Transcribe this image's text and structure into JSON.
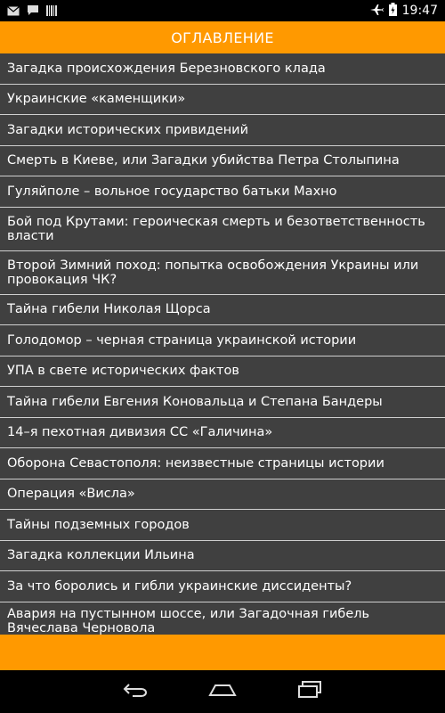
{
  "status_bar": {
    "time": "19:47",
    "left_icons": [
      "email-icon",
      "chat-icon",
      "barcode-icon"
    ],
    "right_icons": [
      "airplane-mode-icon",
      "battery-charging-icon"
    ]
  },
  "header": {
    "title": "ОГЛАВЛЕНИЕ",
    "color": "#FF9900"
  },
  "list": {
    "background": "#404040",
    "items": [
      "Загадка происхождения Березновского клада",
      "Украинские «каменщики»",
      "Загадки исторических привидений",
      "Смерть в Киеве, или Загадки убийства Петра Столыпина",
      "Гуляйполе – вольное государство батьки Махно",
      "Бой под Крутами: героическая смерть и безответственность власти",
      "Второй Зимний поход: попытка освобождения Украины или провокация ЧК?",
      "Тайна гибели Николая Щорса",
      "Голодомор – черная страница украинской истории",
      "УПА в свете исторических фактов",
      "Тайна гибели Евгения Коновальца и Степана Бандеры",
      "14–я пехотная дивизия СС «Галичина»",
      "Оборона Севастополя: неизвестные страницы истории",
      "Операция «Висла»",
      "Тайны подземных городов",
      "Загадка коллекции Ильина",
      "За что боролись и гибли украинские диссиденты?",
      "Авария на пустынном шоссе, или Загадочная гибель Вячеслава Черновола"
    ]
  },
  "nav_bar": {
    "buttons": [
      "back-icon",
      "home-icon",
      "recent-apps-icon"
    ]
  }
}
